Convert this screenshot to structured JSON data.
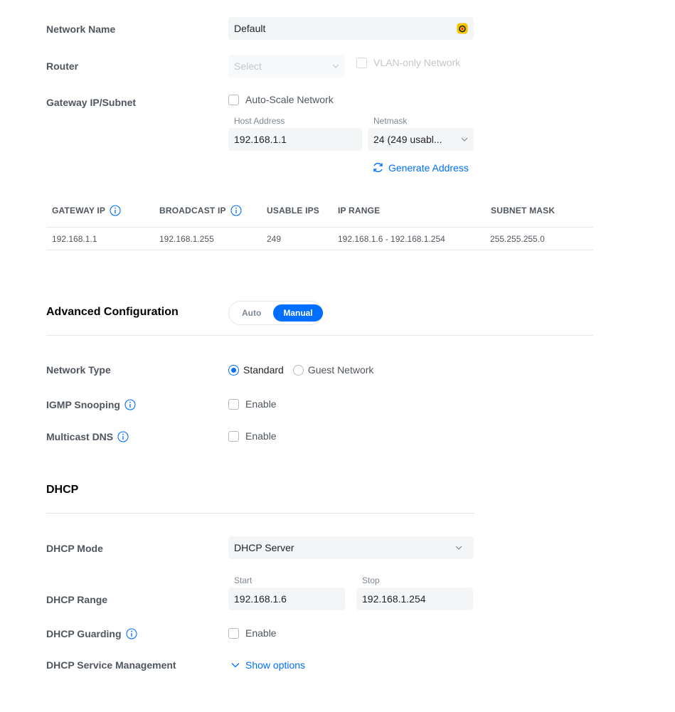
{
  "colors": {
    "accent": "#006fff",
    "label": "#50565e",
    "field_bg": "#f4f5f6",
    "divider": "#e4e6e9"
  },
  "network_name": {
    "label": "Network Name",
    "value": "Default",
    "icon": "assistant-icon"
  },
  "router": {
    "label": "Router",
    "placeholder": "Select",
    "vlan_only": "VLAN-only Network"
  },
  "gateway": {
    "label": "Gateway IP/Subnet",
    "auto_scale": "Auto-Scale Network",
    "host_label": "Host Address",
    "host_value": "192.168.1.1",
    "netmask_label": "Netmask",
    "netmask_value": "24 (249 usabl...",
    "generate": "Generate Address"
  },
  "table": {
    "headers": [
      "GATEWAY IP",
      "BROADCAST IP",
      "USABLE IPS",
      "IP RANGE",
      "SUBNET MASK"
    ],
    "row": [
      "192.168.1.1",
      "192.168.1.255",
      "249",
      "192.168.1.6 - 192.168.1.254",
      "255.255.255.0"
    ]
  },
  "advanced": {
    "title": "Advanced Configuration",
    "modes": [
      "Auto",
      "Manual"
    ],
    "selected_mode": "Manual",
    "network_type_label": "Network Type",
    "network_type_options": [
      "Standard",
      "Guest Network"
    ],
    "network_type_selected": "Standard",
    "igmp_label": "IGMP Snooping",
    "igmp_option": "Enable",
    "mdns_label": "Multicast DNS",
    "mdns_option": "Enable"
  },
  "dhcp": {
    "title": "DHCP",
    "mode_label": "DHCP Mode",
    "mode_value": "DHCP Server",
    "range_label": "DHCP Range",
    "start_label": "Start",
    "start_value": "192.168.1.6",
    "stop_label": "Stop",
    "stop_value": "192.168.1.254",
    "guarding_label": "DHCP Guarding",
    "guarding_option": "Enable",
    "service_label": "DHCP Service Management",
    "show_options": "Show options"
  }
}
